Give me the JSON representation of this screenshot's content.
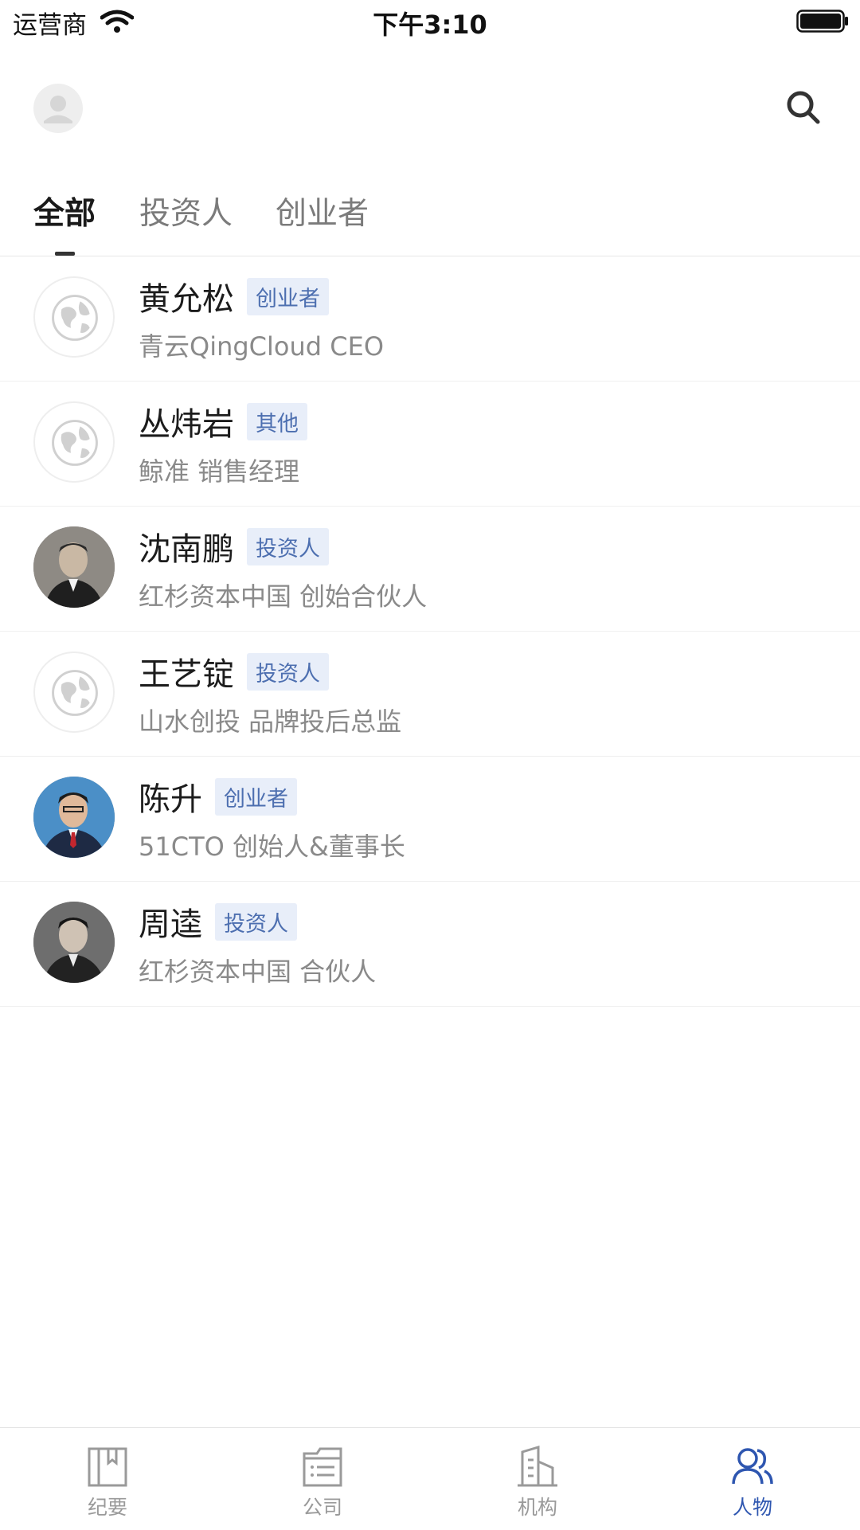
{
  "status_bar": {
    "carrier": "运营商",
    "time": "下午3:10"
  },
  "header": {
    "avatar_icon": "user-avatar-icon",
    "search_icon": "search-icon"
  },
  "tabs": [
    {
      "label": "全部",
      "active": true
    },
    {
      "label": "投资人",
      "active": false
    },
    {
      "label": "创业者",
      "active": false
    }
  ],
  "people": [
    {
      "name": "黄允松",
      "tag": "创业者",
      "subtitle": "青云QingCloud  CEO",
      "avatar": "globe-placeholder"
    },
    {
      "name": "丛炜岩",
      "tag": "其他",
      "subtitle": "鲸准  销售经理",
      "avatar": "globe-placeholder"
    },
    {
      "name": "沈南鹏",
      "tag": "投资人",
      "subtitle": "红杉资本中国  创始合伙人",
      "avatar": "photo"
    },
    {
      "name": "王艺锭",
      "tag": "投资人",
      "subtitle": "山水创投  品牌投后总监",
      "avatar": "globe-placeholder"
    },
    {
      "name": "陈升",
      "tag": "创业者",
      "subtitle": "51CTO  创始人&董事长",
      "avatar": "photo"
    },
    {
      "name": "周逵",
      "tag": "投资人",
      "subtitle": "红杉资本中国  合伙人",
      "avatar": "photo"
    }
  ],
  "bottom_nav": [
    {
      "label": "纪要",
      "icon": "bookmark-icon",
      "active": false
    },
    {
      "label": "公司",
      "icon": "list-folder-icon",
      "active": false
    },
    {
      "label": "机构",
      "icon": "building-icon",
      "active": false
    },
    {
      "label": "人物",
      "icon": "people-icon",
      "active": true
    }
  ],
  "colors": {
    "accent": "#2e56b0",
    "tag_text": "#4d6fb0",
    "tag_bg": "#e8eef9",
    "inactive": "#9a9a9a"
  }
}
